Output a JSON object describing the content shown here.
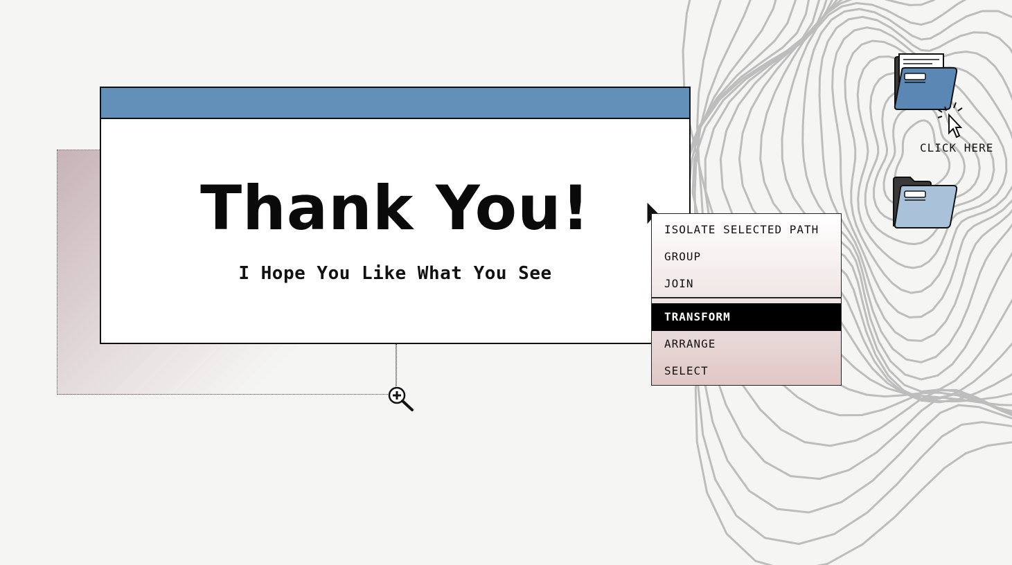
{
  "slide": {
    "headline": "Thank You!",
    "subheadline": "I Hope You Like What You See"
  },
  "context_menu": {
    "items": [
      {
        "label": "ISOLATE SELECTED PATH",
        "active": false
      },
      {
        "label": "GROUP",
        "active": false
      },
      {
        "label": "JOIN",
        "active": false
      },
      {
        "label": "TRANSFORM",
        "active": true
      },
      {
        "label": "ARRANGE",
        "active": false
      },
      {
        "label": "SELECT",
        "active": false
      }
    ]
  },
  "desktop": {
    "folders": [
      {
        "icon": "open-folder-with-document-icon",
        "color": "#5b87b5"
      },
      {
        "icon": "folder-icon",
        "color": "#a9c2d9"
      }
    ],
    "click_label": "CLICK HERE"
  },
  "icons": {
    "zoom": "zoom-in-icon",
    "cursor": "pointer-cursor-icon"
  },
  "colors": {
    "titlebar": "#6290b8",
    "background": "#f5f5f3",
    "menu_active": "#000000"
  }
}
